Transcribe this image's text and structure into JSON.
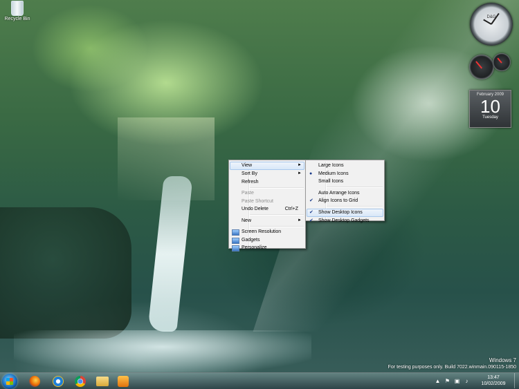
{
  "desktop": {
    "icons": [
      {
        "label": "Recycle Bin",
        "icon": "recycle-bin-icon"
      }
    ]
  },
  "gadgets": {
    "clock": {
      "brand": "D&G"
    },
    "calendar": {
      "month_year": "February 2009",
      "day": "10",
      "weekday": "Tuesday"
    }
  },
  "context_menu": {
    "items": [
      {
        "label": "View",
        "submenu": true,
        "highlighted": true
      },
      {
        "label": "Sort By",
        "submenu": true
      },
      {
        "label": "Refresh"
      },
      {
        "separator": true
      },
      {
        "label": "Paste",
        "disabled": true
      },
      {
        "label": "Paste Shortcut",
        "disabled": true
      },
      {
        "label": "Undo Delete",
        "shortcut": "Ctrl+Z"
      },
      {
        "separator": true
      },
      {
        "label": "New",
        "submenu": true
      },
      {
        "separator": true
      },
      {
        "label": "Screen Resolution",
        "icon": "screen-resolution-icon"
      },
      {
        "label": "Gadgets",
        "icon": "gadgets-icon"
      },
      {
        "label": "Personalize",
        "icon": "personalize-icon"
      }
    ]
  },
  "view_submenu": {
    "items": [
      {
        "label": "Large Icons"
      },
      {
        "label": "Medium Icons",
        "mark": "bullet"
      },
      {
        "label": "Small Icons"
      },
      {
        "separator": true
      },
      {
        "label": "Auto Arrange Icons"
      },
      {
        "label": "Align Icons to Grid",
        "mark": "check"
      },
      {
        "separator": true
      },
      {
        "label": "Show Desktop Icons",
        "mark": "check",
        "highlighted": true
      },
      {
        "label": "Show Desktop Gadgets",
        "mark": "check"
      }
    ]
  },
  "watermark": {
    "os": "Windows 7",
    "build": "For testing purposes only. Build 7022.winmain.090115-1850"
  },
  "taskbar": {
    "start_icon": "windows-start-orb",
    "pinned": [
      {
        "name": "firefox",
        "icon": "firefox-icon",
        "color": "#e66000"
      },
      {
        "name": "internet-explorer",
        "icon": "internet-explorer-icon",
        "color": "#1e7fd8"
      },
      {
        "name": "chrome",
        "icon": "chrome-icon",
        "color": "#e8b51a"
      },
      {
        "name": "explorer",
        "icon": "folder-icon",
        "color": "#e8c060"
      },
      {
        "name": "media-player",
        "icon": "media-player-icon",
        "color": "#f29a1c"
      }
    ],
    "tray": {
      "time": "13:47",
      "date": "10/02/2009"
    }
  }
}
